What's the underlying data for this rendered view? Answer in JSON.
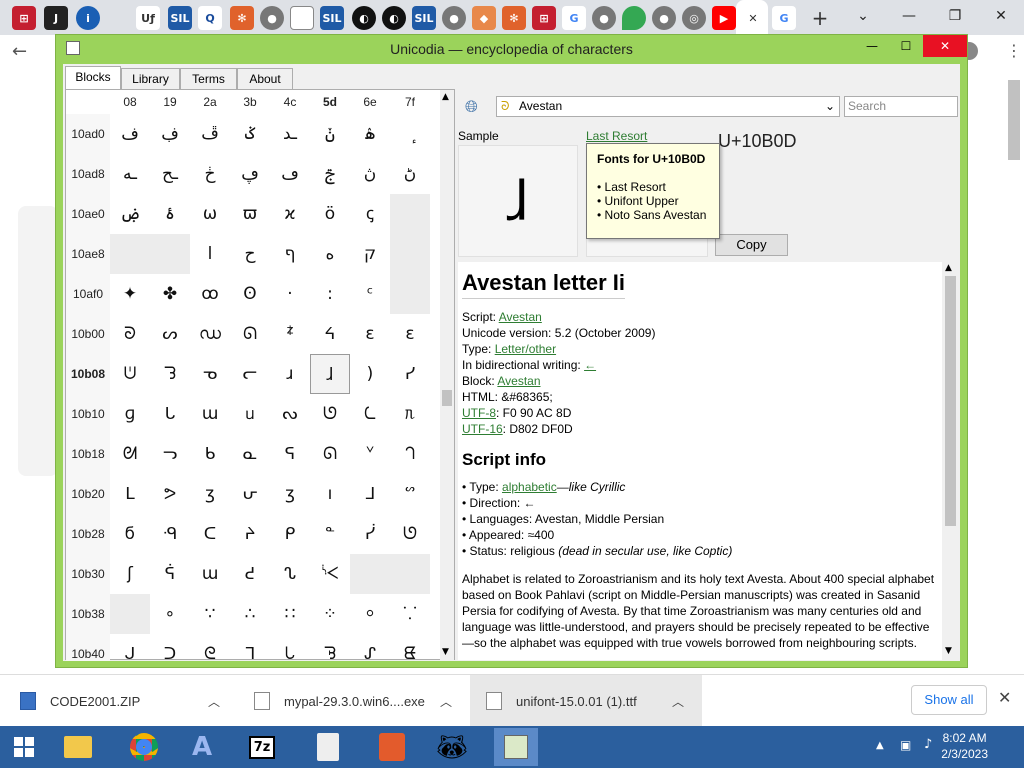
{
  "window": {
    "title": "Unicodia — encyclopedia of characters",
    "minimize": "—",
    "maximize": "☐",
    "close": "✕"
  },
  "tabs": [
    "Blocks",
    "Library",
    "Terms",
    "About"
  ],
  "grid": {
    "columns": [
      "08",
      "19",
      "2a",
      "3b",
      "4c",
      "5d",
      "6e",
      "7f"
    ],
    "rows": [
      {
        "label": "10ad0",
        "cells": [
          "ف",
          "ڣ",
          "ڦ",
          "ݢ",
          "ـد",
          "ݩ",
          "ۿ",
          "ٕ"
        ]
      },
      {
        "label": "10ad8",
        "cells": [
          "ـه",
          "ـح",
          "ڂ",
          "ڥ",
          "ڡ",
          "ࢢ",
          "ڽ",
          "ڻ"
        ]
      },
      {
        "label": "10ae0",
        "cells": [
          "ۻ",
          "ۂ",
          "ω",
          "ϖ",
          "ϰ",
          "ö",
          "ꞔ",
          ""
        ]
      },
      {
        "label": "10ae8",
        "cells": [
          "",
          "",
          "ا",
          "ح",
          "ף",
          "ه",
          "ק",
          ""
        ]
      },
      {
        "label": "10af0",
        "cells": [
          "✦",
          "✤",
          "ꝏ",
          "ʘ",
          "·",
          ":",
          "ᶜ",
          ""
        ]
      },
      {
        "label": "10b00",
        "cells": [
          "ᘐ",
          "ᔕ",
          "ഡ",
          "ᘏ",
          "ᙇ",
          "ᔦ",
          "ɛ",
          "ɛ"
        ]
      },
      {
        "label": "10b08",
        "cells": [
          "ᕫ",
          "ᘊ",
          "ᓀ",
          "ᓕ",
          "ɹ",
          "ɺ",
          ")",
          "ᓯ"
        ]
      },
      {
        "label": "10b10",
        "cells": [
          "ɡ",
          "ᒐ",
          "ɯ",
          "ᥙ",
          "ᔓ",
          "ᘎ",
          "ᘇ",
          "ᥰ"
        ]
      },
      {
        "label": "10b18",
        "cells": [
          "ᘛ",
          "ᓓ",
          "ᑲ",
          "ᓇ",
          "ᕋ",
          "ᘏ",
          "ᘁ",
          "ᘃ"
        ]
      },
      {
        "label": "10b20",
        "cells": [
          "ᒪ",
          "ᕗ",
          "ʒ",
          "ᕂ",
          "ʒ",
          "ı",
          "ᒧ",
          "ᔥ"
        ]
      },
      {
        "label": "10b28",
        "cells": [
          "ϭ",
          "ᑴ",
          "ᑕ",
          "ᔨ",
          "ᑭ",
          "ᓐ",
          "ᓰ",
          "ᘎ"
        ]
      },
      {
        "label": "10b30",
        "cells": [
          "ʃ",
          "ᕌ",
          "ɯ",
          "ᕍ",
          "ᔐ",
          "ᔌ",
          "",
          ""
        ]
      },
      {
        "label": "10b38",
        "cells": [
          "",
          "∘",
          "∵",
          "∴",
          "∷",
          "⁘",
          "⸰",
          "⸪"
        ]
      },
      {
        "label": "10b40",
        "cells": [
          "ᒍ",
          "ᑐ",
          "ᘓ",
          "ᒣ",
          "ᘂ",
          "ᘋ",
          "ᔑ",
          "ᘀ"
        ]
      }
    ],
    "selected_row": "10b08",
    "selected_col": "5d"
  },
  "block_selector": {
    "icon": "ᘐ",
    "value": "Avestan",
    "chevron": "⌄"
  },
  "search": {
    "placeholder": "Search"
  },
  "sample": {
    "label": "Sample",
    "glyph": "ɺ",
    "font_link": "Last Resort",
    "codepoint": "U+10B0D",
    "copy": "Copy"
  },
  "tooltip": {
    "title": "Fonts for U+10B0D",
    "fonts": [
      "• Last Resort",
      "• Unifont Upper",
      "• Noto Sans Avestan"
    ]
  },
  "info": {
    "heading": "Avestan letter Ii",
    "script_label": "Script: ",
    "script": "Avestan",
    "version": "Unicode version: 5.2 (October 2009)",
    "type_label": "Type: ",
    "type": "Letter/other",
    "bidi_label": "In bidirectional writing: ",
    "bidi": "←",
    "block_label": "Block: ",
    "block": "Avestan",
    "html": "HTML: &#68365;",
    "utf8_label": "UTF-8",
    "utf8": ": F0 90 AC 8D",
    "utf16_label": "UTF-16",
    "utf16": ": D802 DF0D",
    "script_info_heading": "Script info",
    "si_type_label": "• Type: ",
    "si_type": "alphabetic",
    "si_type_rest": "—like Cyrillic",
    "si_direction": "• Direction: ←",
    "si_languages": "• Languages: Avestan, Middle Persian",
    "si_appeared": "• Appeared: ≈400",
    "si_status": "• Status: religious ",
    "si_status_note": "(dead in secular use, like Coptic)",
    "paragraph": "Alphabet is related to Zoroastrianism and its holy text Avesta. About 400 special alphabet based on Book Pahlavi (script on Middle-Persian manuscripts) was created in Sasanid Persia for codifying of Avesta. By that time Zoroastrianism was many centuries old and language was little-understood, and prayers should be precisely repeated to be effective—so the alphabet was equipped with true vowels borrowed from neighbouring scripts."
  },
  "downloads": [
    {
      "name": "CODE2001.ZIP"
    },
    {
      "name": "mypal-29.3.0.win6....exe"
    },
    {
      "name": "unifont-15.0.01 (1).ttf"
    }
  ],
  "show_all": "Show all",
  "clock": {
    "time": "8:02 AM",
    "date": "2/3/2023"
  }
}
